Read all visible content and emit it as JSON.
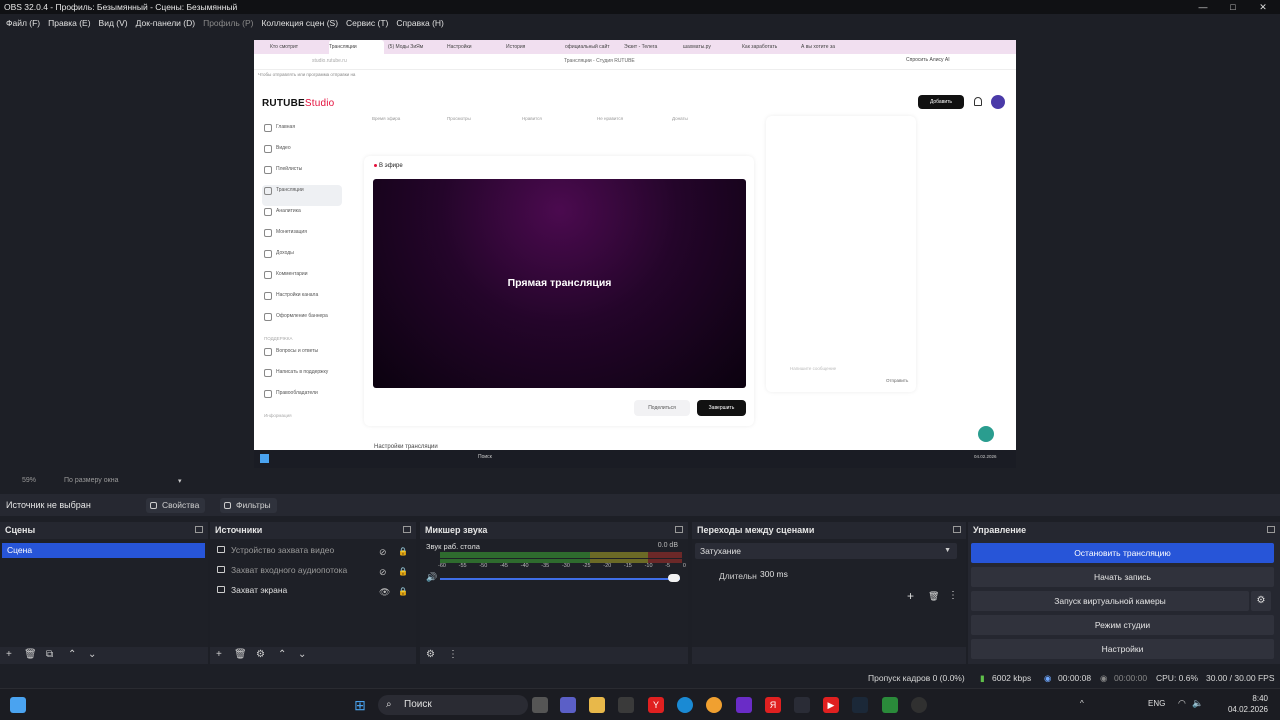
{
  "window": {
    "title": "OBS 32.0.4 - Профиль: Безымянный - Сцены: Безымянный",
    "controls": [
      "—",
      "□",
      "✕"
    ]
  },
  "menu": [
    "Файл (F)",
    "Правка (E)",
    "Вид (V)",
    "Док-панели (D)",
    "Профиль (P)",
    "Коллекция сцен (S)",
    "Сервис (T)",
    "Справка (H)"
  ],
  "preview": {
    "browser_tabs": [
      "Кто смотрит",
      "Трансляции",
      "(5) Моды ЗиЯм",
      "Настройки",
      "История",
      "официальный сайт",
      "Экзит - Телега",
      "шахматы.ру",
      "Как заработать",
      "А вы хотите за"
    ],
    "address": "studio.rutube.ru",
    "page_title": "Трансляции - Студия RUTUBE",
    "ai_button": "Спросить Алису AI",
    "info": "Чтобы отправлять или программа отправки на",
    "logo_main": "RUTUBE",
    "logo_sub": "Studio",
    "add_button": "Добавить",
    "nav": [
      "Главная",
      "Видео",
      "Плейлисты",
      "Трансляции",
      "Аналитика",
      "Монетизация",
      "Доходы",
      "Комментарии",
      "Настройки канала",
      "Оформление баннера"
    ],
    "nav_section": "ПОДДЕРЖКА",
    "nav_support": [
      "Вопросы и ответы",
      "Написать в поддержку",
      "Правообладатели"
    ],
    "nav_footer": "Информация",
    "stats": [
      "Время эфира",
      "Просмотры",
      "Нравится",
      "Не нравится",
      "Донаты"
    ],
    "live_label": "В эфире",
    "video_title": "Прямая трансляция",
    "share_button": "Поделиться",
    "end_button": "Завершить",
    "chat_input": "Напишите сообщение",
    "chat_send": "Отправить",
    "settings_peek": "Настройки трансляции",
    "inner_search": "Поиск",
    "inner_clock": "04.02.2026"
  },
  "zoom": {
    "value": "59%",
    "mode": "По размеру окна"
  },
  "source_bar": {
    "no_source": "Источник не выбран",
    "properties": "Свойства",
    "filters": "Фильтры"
  },
  "docks": {
    "scenes": {
      "title": "Сцены",
      "items": [
        "Сцена"
      ]
    },
    "sources": {
      "title": "Источники",
      "items": [
        {
          "name": "Устройство захвата видео",
          "visible": false
        },
        {
          "name": "Захват входного аудиопотока",
          "visible": false
        },
        {
          "name": "Захват экрана",
          "visible": true
        }
      ]
    },
    "mixer": {
      "title": "Микшер звука",
      "channel": "Звук раб. стола",
      "db": "0.0 dB",
      "ticks": [
        "-60",
        "-55",
        "-50",
        "-45",
        "-40",
        "-35",
        "-30",
        "-25",
        "-20",
        "-15",
        "-10",
        "-5",
        "0"
      ],
      "volume": 1.0
    },
    "transitions": {
      "title": "Переходы между сценами",
      "selected": "Затухание",
      "duration_label": "Длительность",
      "duration_value": "300 ms"
    },
    "controls": {
      "title": "Управление",
      "stop_stream": "Остановить трансляцию",
      "start_record": "Начать запись",
      "virtual_cam": "Запуск виртуальной камеры",
      "studio_mode": "Режим студии",
      "settings": "Настройки"
    }
  },
  "status": {
    "dropped": "Пропуск кадров 0 (0.0%)",
    "bitrate": "6002 kbps",
    "stream_time": "00:00:08",
    "record_time": "00:00:00",
    "cpu": "CPU: 0.6%",
    "fps": "30.00 / 30.00 FPS"
  },
  "taskbar": {
    "search": "Поиск",
    "lang": "ENG",
    "time": "8:40",
    "date": "04.02.2026"
  },
  "colors": {
    "accent": "#2755d8",
    "rutube_red": "#e4103c"
  }
}
